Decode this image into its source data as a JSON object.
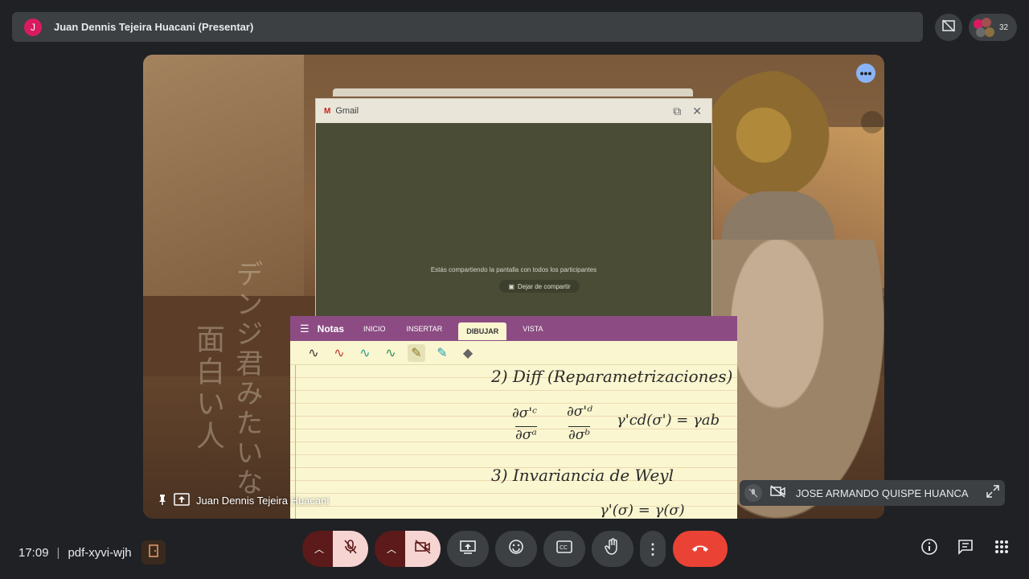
{
  "top_bar": {
    "avatar_letter": "J",
    "presenter_title": "Juan Dennis Tejeira Huacani (Presentar)",
    "participant_count": "32"
  },
  "stage": {
    "jp_col1": "面白い人",
    "jp_col2": "デンジ君みたいな",
    "presenter_name": "Juan Dennis Tejeira Huacani"
  },
  "gmail_window": {
    "title": "Gmail",
    "share_message": "Estás compartiendo la pantalla con todos los participantes",
    "stop_share_label": "Dejar de compartir"
  },
  "onenote": {
    "app_name": "Notas",
    "tabs": [
      "INICIO",
      "INSERTAR",
      "DIBUJAR",
      "VISTA"
    ],
    "active_tab": "DIBUJAR",
    "notes": {
      "line1": "2) Diff (Reparametrizaciones)",
      "line2a": "∂σ'ᶜ",
      "line2b": "∂σᵃ",
      "line2c": "∂σ'ᵈ",
      "line2d": "∂σᵇ",
      "line2e": "γ'cd(σ') = γab",
      "line3": "3) Invariancia de Weyl",
      "line4": "γ'(σ) = γ(σ)"
    }
  },
  "pip": {
    "name": "JOSE ARMANDO QUISPE HUANCA"
  },
  "bottom_bar": {
    "time": "17:09",
    "meeting_code": "pdf-xyvi-wjh"
  },
  "colors": {
    "accent_blue": "#8ab4f8",
    "end_call_red": "#ea4335",
    "onenote_purple": "#8c4c83"
  }
}
